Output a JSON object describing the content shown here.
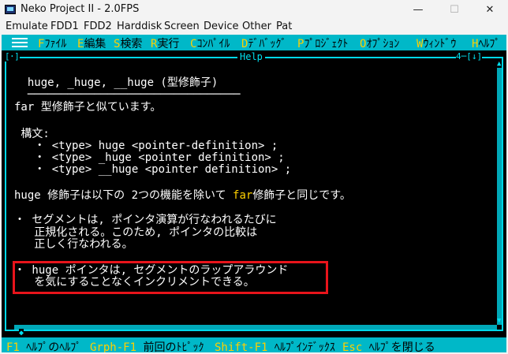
{
  "window": {
    "title": "Neko Project II - 2.0FPS",
    "controls": {
      "minimize": "—",
      "maximize": "☐",
      "close": "✕"
    }
  },
  "menubar": [
    "Emulate",
    "FDD1",
    "FDD2",
    "Harddisk",
    "Screen",
    "Device",
    "Other",
    "Pat"
  ],
  "dos_menu": [
    {
      "key": "F",
      "label": "ﾌｧｲﾙ"
    },
    {
      "key": "E",
      "label": "編集"
    },
    {
      "key": "S",
      "label": "検索"
    },
    {
      "key": "R",
      "label": "実行"
    },
    {
      "key": "C",
      "label": "ｺﾝﾊﾟｲﾙ"
    },
    {
      "key": "D",
      "label": "ﾃﾞﾊﾞｯｸﾞ"
    },
    {
      "key": "P",
      "label": "ﾌﾟﾛｼﾞｪｸﾄ"
    },
    {
      "key": "O",
      "label": "ｵﾌﾟｼｮﾝ"
    },
    {
      "key": "W",
      "label": "ｳｨﾝﾄﾞｳ"
    },
    {
      "key": "H",
      "label": "ﾍﾙﾌﾟ"
    }
  ],
  "help_window": {
    "title": "Help",
    "close_box": "[･]",
    "number_box": "4─[↓]",
    "bottom_left": "◆",
    "lines": [
      {
        "text": "  huge, _huge, __huge (型修飾子)"
      },
      {
        "text": "  ────────────────────────────────"
      },
      {
        "text": "far 型修飾子と似ています。"
      },
      {
        "text": ""
      },
      {
        "text": " 構文:"
      },
      {
        "text": "   ・ <type> huge <pointer-definition> ;"
      },
      {
        "text": "   ・ <type> _huge <pointer definition> ;"
      },
      {
        "text": "   ・ <type> __huge <pointer definition> ;"
      },
      {
        "text": ""
      },
      {
        "text_before": "huge 修飾子は以下の 2つの機能を除いて ",
        "link": "far",
        "text_after": "修飾子と同じです。"
      },
      {
        "text": ""
      },
      {
        "text": "・ セグメントは, ポインタ演算が行なわれるたびに"
      },
      {
        "text": "   正規化される。このため, ポインタの比較は"
      },
      {
        "text": "   正しく行なわれる。"
      },
      {
        "text": ""
      },
      {
        "text": "・ huge ポインタは, セグメントのラップアラウンド"
      },
      {
        "text": "   を気にすることなくインクリメントできる。"
      }
    ]
  },
  "statusbar": [
    {
      "key": "F1",
      "label": "ﾍﾙﾌﾟのﾍﾙﾌﾟ"
    },
    {
      "key": "Grph-F1",
      "label": "前回のﾄﾋﾟｯｸ"
    },
    {
      "key": "Shift-F1",
      "label": "ﾍﾙﾌﾟｲﾝﾃﾞｯｸｽ"
    },
    {
      "key": "Esc",
      "label": "ﾍﾙﾌﾟを閉じる"
    }
  ],
  "colors": {
    "cyan_bar": "#00b8c8",
    "frame": "#00d8e8",
    "hotkey": "#ffd000",
    "annotation": "#e8141b"
  }
}
